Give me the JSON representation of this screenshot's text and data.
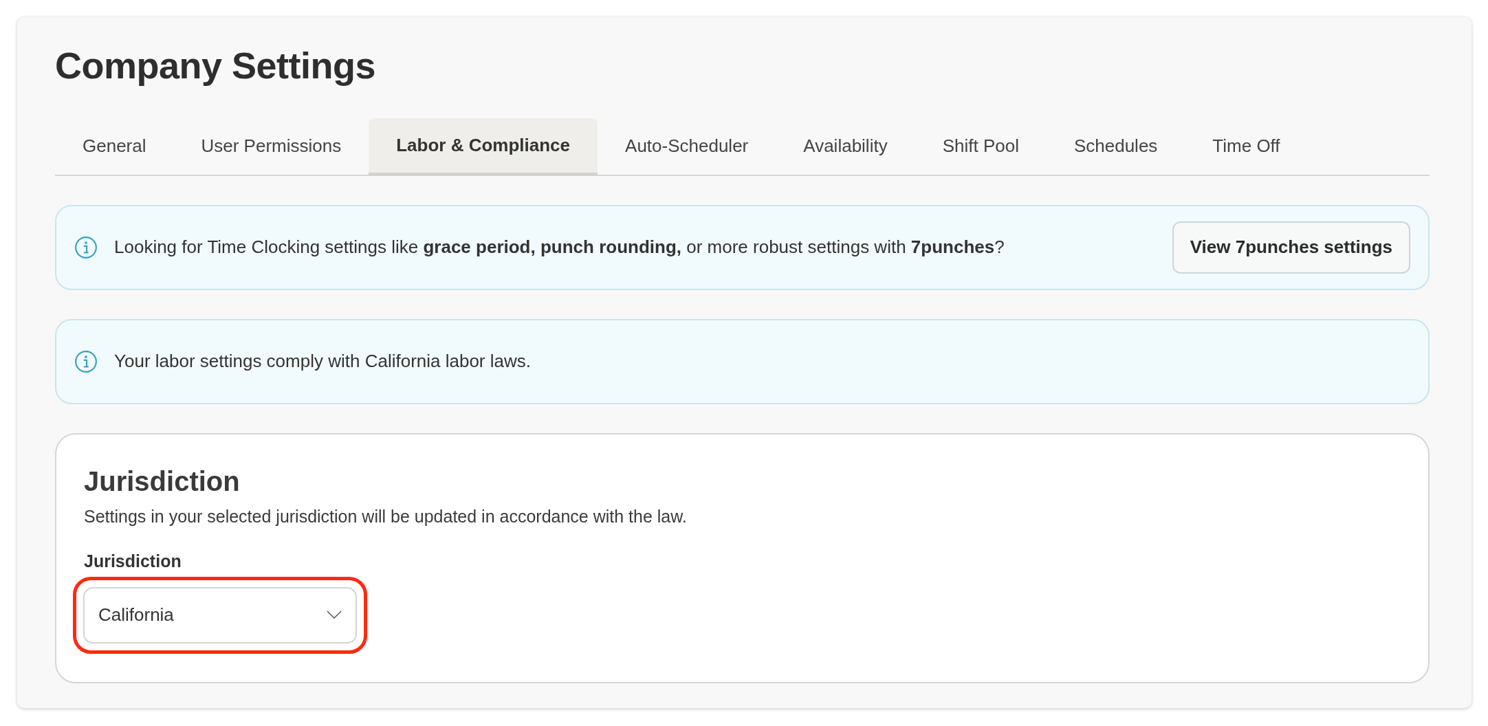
{
  "page": {
    "title": "Company Settings"
  },
  "tabs": [
    {
      "label": "General",
      "selected": false
    },
    {
      "label": "User Permissions",
      "selected": false
    },
    {
      "label": "Labor & Compliance",
      "selected": true
    },
    {
      "label": "Auto-Scheduler",
      "selected": false
    },
    {
      "label": "Availability",
      "selected": false
    },
    {
      "label": "Shift Pool",
      "selected": false
    },
    {
      "label": "Schedules",
      "selected": false
    },
    {
      "label": "Time Off",
      "selected": false
    }
  ],
  "banners": [
    {
      "text": "Looking for Time Clocking settings like **grace period, punch rounding,** or more robust settings with **7punches**?",
      "button": "View 7punches settings"
    },
    {
      "text": "Your labor settings comply with California labor laws."
    }
  ],
  "jurisdiction": {
    "title": "Jurisdiction",
    "description": "Settings in your selected jurisdiction will be updated in accordance with the law.",
    "field": {
      "label": "Jurisdiction",
      "value": "California",
      "highlighted": true
    }
  }
}
